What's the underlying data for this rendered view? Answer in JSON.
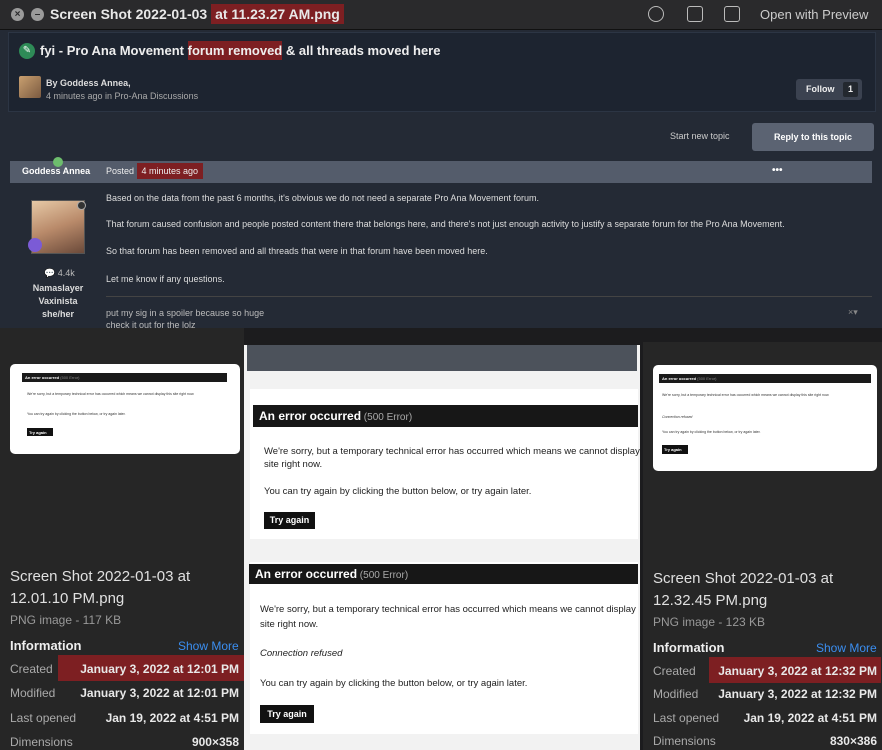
{
  "window": {
    "title_prefix": "Screen Shot 2022-01-03 ",
    "title_highlight": "at 11.23.27 AM.png",
    "open_with": "Open with Preview"
  },
  "thread": {
    "title_a": "fyi - Pro Ana Movement ",
    "title_b": "forum removed",
    "title_c": " & all threads moved here",
    "by": "By Goddess Annea,",
    "time": "4 minutes ago in Pro-Ana Discussions",
    "follow_label": "Follow",
    "follow_count": "1",
    "start_topic": "Start new topic",
    "reply": "Reply to this topic"
  },
  "post": {
    "author": "Goddess Annea",
    "posted_label": "Posted ",
    "posted_time": "4 minutes ago",
    "ellipsis": "•••",
    "count": "4.4k",
    "side1": "Namaslayer",
    "side2": "Vaxinista",
    "side3": "she/her",
    "p1": "Based on the data from the past 6 months, it's obvious we do not need a separate Pro Ana Movement forum.",
    "p2": "That forum caused confusion and people posted content there that belongs here, and there's not just enough activity to justify a separate forum for the Pro Ana Movement.",
    "p3": "So that forum has been removed and all threads that were in that forum have been moved here.",
    "p4": "Let me know if any questions.",
    "sig1": "put my sig in a spoiler because so huge",
    "sig2": "check it out for the lolz"
  },
  "left": {
    "thumb": {
      "bar": "An error occurred",
      "bar_sm": "(500 Error)",
      "l1": "We're sorry, but a temporary technical error has occurred which means we cannot display this site right now.",
      "l2": "You can try again by clicking the button below, or try again later.",
      "btn": "Try again"
    },
    "name1": "Screen Shot 2022-01-03 at",
    "name2": "12.01.10 PM.png",
    "type": "PNG image - 117 KB",
    "info": "Information",
    "show_more": "Show More",
    "created_l": "Created",
    "created_v": "January 3, 2022 at 12:01 PM",
    "modified_l": "Modified",
    "modified_v": "January 3, 2022 at 12:01 PM",
    "opened_l": "Last opened",
    "opened_v": "Jan 19, 2022 at 4:51 PM",
    "dim_l": "Dimensions",
    "dim_v": "900×358"
  },
  "center": {
    "e1_title": "An error occurred",
    "e1_sm": " (500 Error)",
    "e1_l1": "We're sorry, but a temporary technical error has occurred which means we cannot display this",
    "e1_l2": "site right now.",
    "e1_l3": "You can try again by clicking the button below, or try again later.",
    "e1_btn": "Try again",
    "e2_title": "An error occurred",
    "e2_sm": " (500 Error)",
    "e2_l1": "We're sorry, but a temporary technical error has occurred which means we cannot display",
    "e2_l2": "site right now.",
    "e2_l3": "Connection refused",
    "e2_l4": "You can try again by clicking the button below, or try again later.",
    "e2_btn": "Try again"
  },
  "right": {
    "thumb": {
      "bar": "An error occurred",
      "bar_sm": "(500 Error)",
      "l1": "We're sorry, but a temporary technical error has occurred which means we cannot display this site right now.",
      "l2": "Connection refused",
      "l3": "You can try again by clicking the button below, or try again later.",
      "btn": "Try again"
    },
    "name1": "Screen Shot 2022-01-03 at",
    "name2": "12.32.45 PM.png",
    "type": "PNG image - 123 KB",
    "info": "Information",
    "show_more": "Show More",
    "created_l": "Created",
    "created_v": "January 3, 2022 at 12:32 PM",
    "modified_l": "Modified",
    "modified_v": "January 3, 2022 at 12:32 PM",
    "opened_l": "Last opened",
    "opened_v": "Jan 19, 2022 at 4:51 PM",
    "dim_l": "Dimensions",
    "dim_v": "830×386"
  }
}
